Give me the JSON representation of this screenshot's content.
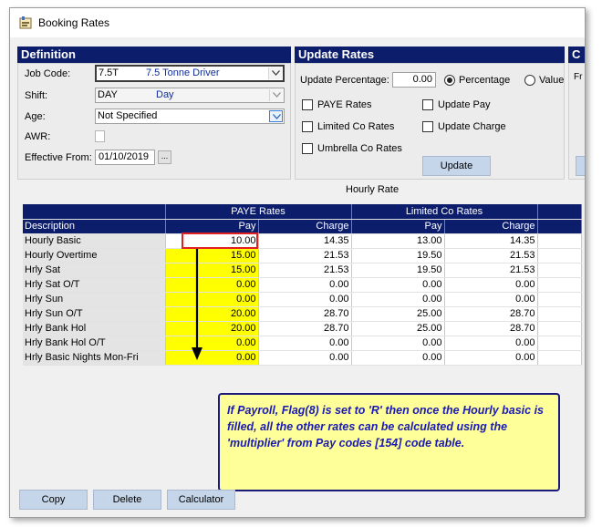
{
  "window": {
    "title": "Booking Rates"
  },
  "definition": {
    "header": "Definition",
    "job_code_label": "Job Code:",
    "job_code_value": "7.5T",
    "job_code_desc": "7.5 Tonne Driver",
    "shift_label": "Shift:",
    "shift_value": "DAY",
    "shift_desc": "Day",
    "age_label": "Age:",
    "age_value": "Not Specified",
    "awr_label": "AWR:",
    "effective_label": "Effective From:",
    "effective_value": "01/10/2019",
    "effective_btn": "..."
  },
  "update_rates": {
    "header": "Update Rates",
    "pct_label": "Update Percentage:",
    "pct_value": "0.00",
    "radio_percentage": "Percentage",
    "radio_value": "Value",
    "paye_label": "PAYE Rates",
    "limited_label": "Limited Co Rates",
    "umbrella_label": "Umbrella Co Rates",
    "update_pay_label": "Update Pay",
    "update_charge_label": "Update Charge",
    "update_button": "Update"
  },
  "third_panel": {
    "header": "C",
    "label_fragment": "Fr"
  },
  "grid": {
    "caption": "Hourly Rate",
    "group_headers": [
      "PAYE Rates",
      "Limited Co Rates"
    ],
    "col_headers": [
      "Description",
      "Pay",
      "Charge",
      "Pay",
      "Charge"
    ],
    "rows": [
      {
        "desc": "Hourly Basic",
        "cells": [
          "10.00",
          "14.35",
          "13.00",
          "14.35"
        ]
      },
      {
        "desc": "Hourly Overtime",
        "cells": [
          "15.00",
          "21.53",
          "19.50",
          "21.53"
        ]
      },
      {
        "desc": "Hrly Sat",
        "cells": [
          "15.00",
          "21.53",
          "19.50",
          "21.53"
        ]
      },
      {
        "desc": "Hrly Sat O/T",
        "cells": [
          "0.00",
          "0.00",
          "0.00",
          "0.00"
        ]
      },
      {
        "desc": "Hrly Sun",
        "cells": [
          "0.00",
          "0.00",
          "0.00",
          "0.00"
        ]
      },
      {
        "desc": "Hrly Sun O/T",
        "cells": [
          "20.00",
          "28.70",
          "25.00",
          "28.70"
        ]
      },
      {
        "desc": "Hrly Bank Hol",
        "cells": [
          "20.00",
          "28.70",
          "25.00",
          "28.70"
        ]
      },
      {
        "desc": "Hrly Bank Hol O/T",
        "cells": [
          "0.00",
          "0.00",
          "0.00",
          "0.00"
        ]
      },
      {
        "desc": "Hrly Basic Nights Mon-Fri",
        "cells": [
          "0.00",
          "0.00",
          "0.00",
          "0.00"
        ]
      }
    ]
  },
  "note": {
    "text": "If Payroll, Flag(8) is set to 'R' then once the Hourly basic is filled, all the other rates can be calculated using the 'multiplier' from Pay codes [154] code table."
  },
  "buttons": {
    "copy": "Copy",
    "delete": "Delete",
    "calculator": "Calculator"
  },
  "colors": {
    "header_navy": "#0c1d6b",
    "highlight_yellow": "#ffff00",
    "note_bg": "#ffff99",
    "note_text": "#1a1ab4",
    "callout_red": "#e02020"
  }
}
